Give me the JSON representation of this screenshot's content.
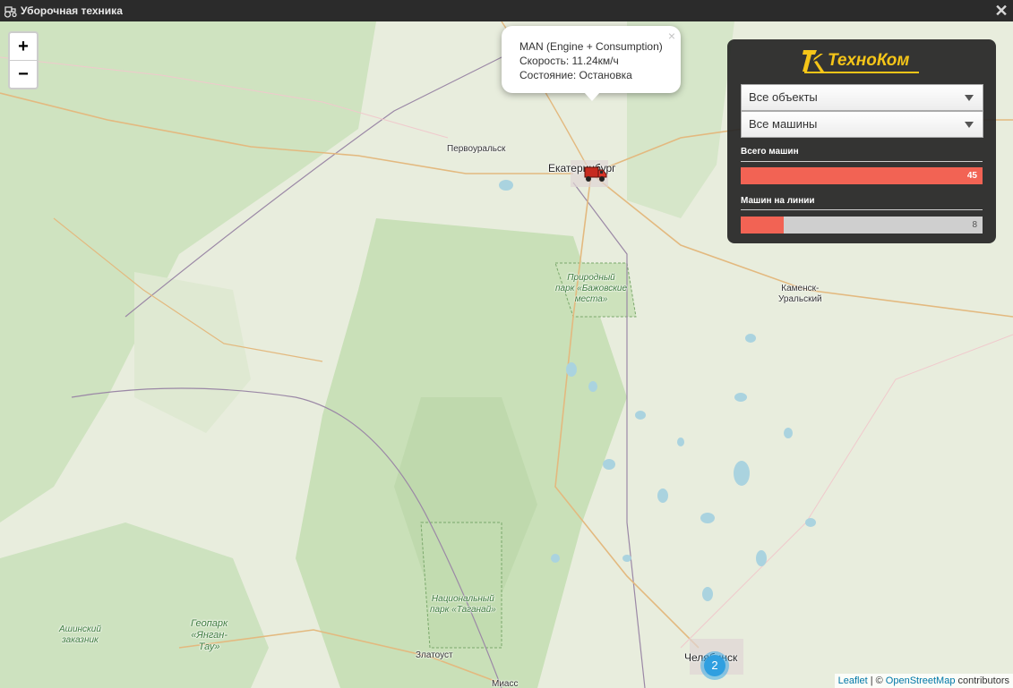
{
  "window": {
    "title": "Уборочная техника",
    "close_glyph": "✕"
  },
  "map": {
    "zoom_in": "+",
    "zoom_out": "−",
    "labels": {
      "pervouralsk": "Первоуральск",
      "ekaterinburg": "Екатеринбург",
      "kamensk": "Каменск-\nУральский",
      "bazhov_park": "Природный\nпарк «Бажовские\nместа»",
      "taganay": "Национальный\nпарк «Таганай»",
      "asha": "Ашинский\nзаказник",
      "geopark": "Геопарк\n«Янган-\nТау»",
      "zlatoust": "Златоуст",
      "chelyabinsk": "Челябинск",
      "miass": "Миасс"
    },
    "cluster_count": "2",
    "attribution": {
      "leaflet": "Leaflet",
      "separator": "| ©",
      "osm": "OpenStreetMap",
      "suffix": "contributors"
    }
  },
  "popup": {
    "close_glyph": "×",
    "name": "MAN (Engine + Consumption)",
    "speed": "Скорость: 11.24км/ч",
    "state": "Состояние: Остановка"
  },
  "panel": {
    "brand": "ТехноКом",
    "objects_select": "Все объекты",
    "machines_select": "Все машины",
    "total": {
      "label": "Всего машин",
      "value": "45",
      "fraction": 1.0
    },
    "online": {
      "label": "Машин на линии",
      "value": "8",
      "fraction": 0.178
    }
  },
  "colors": {
    "accent": "#f26354",
    "brand": "#f5c518",
    "cluster": "#2f9fe0",
    "titlebar": "#2b2b2b"
  },
  "icons": {
    "title": "tractor-icon",
    "vehicle": "truck-icon"
  }
}
